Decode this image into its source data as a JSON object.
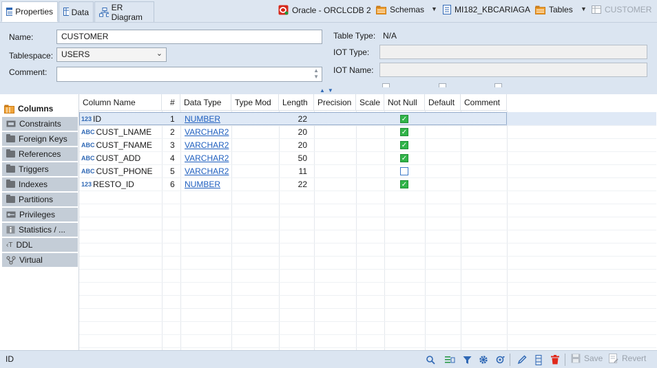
{
  "tabs": [
    {
      "label": "Properties"
    },
    {
      "label": "Data"
    },
    {
      "label": "ER Diagram"
    }
  ],
  "breadcrumb": {
    "connection": "Oracle - ORCLCDB 2",
    "schemas": "Schemas",
    "schema": "MI182_KBCARIAGA",
    "tables": "Tables",
    "table": "CUSTOMER"
  },
  "props": {
    "name_label": "Name:",
    "name_value": "CUSTOMER",
    "tablespace_label": "Tablespace:",
    "tablespace_value": "USERS",
    "comment_label": "Comment:",
    "comment_value": "",
    "table_type_label": "Table Type:",
    "table_type_value": "N/A",
    "iot_type_label": "IOT Type:",
    "iot_type_value": "",
    "iot_name_label": "IOT Name:",
    "iot_name_value": ""
  },
  "sidenav": [
    {
      "label": "Columns"
    },
    {
      "label": "Constraints"
    },
    {
      "label": "Foreign Keys"
    },
    {
      "label": "References"
    },
    {
      "label": "Triggers"
    },
    {
      "label": "Indexes"
    },
    {
      "label": "Partitions"
    },
    {
      "label": "Privileges"
    },
    {
      "label": "Statistics / ..."
    },
    {
      "label": "DDL"
    },
    {
      "label": "Virtual"
    }
  ],
  "grid": {
    "headers": [
      "Column Name",
      "#",
      "Data Type",
      "Type Mod",
      "Length",
      "Precision",
      "Scale",
      "Not Null",
      "Default",
      "Comment"
    ],
    "rows": [
      {
        "icon": "123",
        "name": "ID",
        "num": "1",
        "type": "NUMBER",
        "length": "22",
        "not_null": true
      },
      {
        "icon": "ABC",
        "name": "CUST_LNAME",
        "num": "2",
        "type": "VARCHAR2",
        "length": "20",
        "not_null": true
      },
      {
        "icon": "ABC",
        "name": "CUST_FNAME",
        "num": "3",
        "type": "VARCHAR2",
        "length": "20",
        "not_null": true
      },
      {
        "icon": "ABC",
        "name": "CUST_ADD",
        "num": "4",
        "type": "VARCHAR2",
        "length": "50",
        "not_null": true
      },
      {
        "icon": "ABC",
        "name": "CUST_PHONE",
        "num": "5",
        "type": "VARCHAR2",
        "length": "11",
        "not_null": false
      },
      {
        "icon": "123",
        "name": "RESTO_ID",
        "num": "6",
        "type": "NUMBER",
        "length": "22",
        "not_null": true
      }
    ]
  },
  "status": {
    "text": "ID",
    "save_label": "Save",
    "revert_label": "Revert"
  },
  "colors": {
    "accent": "#1f5fbf",
    "checked": "#31b449",
    "delete": "#e0281b"
  }
}
